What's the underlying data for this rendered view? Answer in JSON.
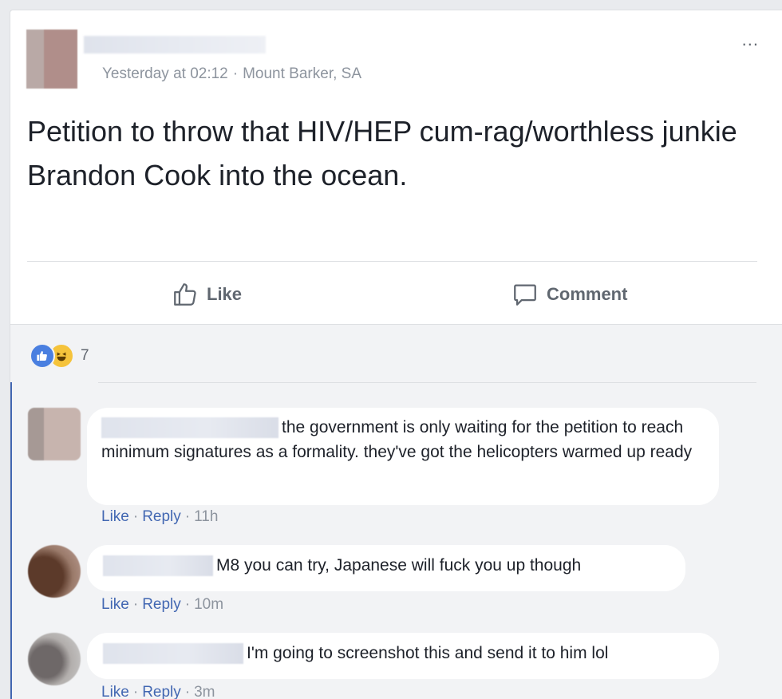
{
  "post": {
    "meta_time": "Yesterday at 02:12",
    "meta_location": "Mount Barker, SA",
    "text": "Petition to throw that HIV/HEP cum-rag/worthless junkie Brandon Cook into the ocean.",
    "more_glyph": "..."
  },
  "actions": {
    "like_label": "Like",
    "comment_label": "Comment"
  },
  "reactions": {
    "count": "7",
    "types": [
      "like-icon",
      "haha-icon"
    ]
  },
  "comments": [
    {
      "text": "the government is only waiting for the petition to reach minimum signatures as a formality. they've got the helicopters warmed up ready",
      "like": "Like",
      "reply": "Reply",
      "time": "11h"
    },
    {
      "text": "M8 you can try, Japanese will fuck you up though",
      "like": "Like",
      "reply": "Reply",
      "time": "10m"
    },
    {
      "text": "I'm going to screenshot this and send it to him lol",
      "like": "Like",
      "reply": "Reply",
      "time": "3m"
    }
  ],
  "colors": {
    "link_blue": "#4267b2",
    "meta_grey": "#8d949e",
    "comment_bg": "#f2f3f5"
  }
}
